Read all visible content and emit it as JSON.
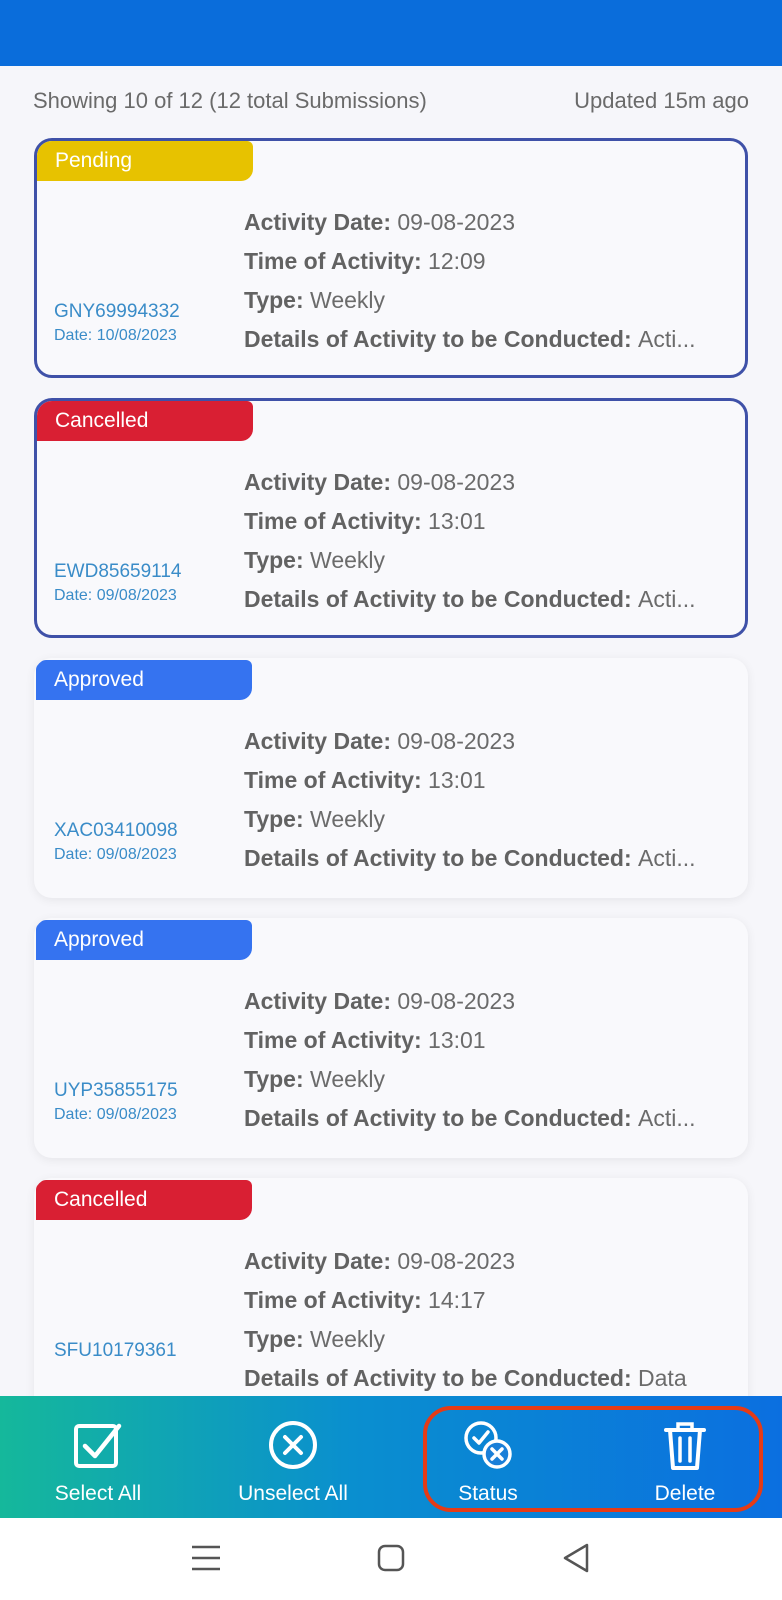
{
  "summary": {
    "showing": "Showing 10 of 12 (12 total Submissions)",
    "updated": "Updated 15m ago"
  },
  "labels": {
    "activity_date": "Activity Date",
    "time_of_activity": "Time of Activity",
    "type": "Type",
    "details": "Details of Activity to be Conducted"
  },
  "cards": [
    {
      "status": "Pending",
      "code": "GNY69994332",
      "date": "Date: 10/08/2023",
      "activity_date": "09-08-2023",
      "time": "12:09",
      "type": "Weekly",
      "details": "Acti..."
    },
    {
      "status": "Cancelled",
      "code": "EWD85659114",
      "date": "Date: 09/08/2023",
      "activity_date": "09-08-2023",
      "time": "13:01",
      "type": "Weekly",
      "details": "Acti..."
    },
    {
      "status": "Approved",
      "code": "XAC03410098",
      "date": "Date: 09/08/2023",
      "activity_date": "09-08-2023",
      "time": "13:01",
      "type": "Weekly",
      "details": "Acti..."
    },
    {
      "status": "Approved",
      "code": "UYP35855175",
      "date": "Date: 09/08/2023",
      "activity_date": "09-08-2023",
      "time": "13:01",
      "type": "Weekly",
      "details": "Acti..."
    },
    {
      "status": "Cancelled",
      "code": "SFU10179361",
      "date": "",
      "activity_date": "09-08-2023",
      "time": "14:17",
      "type": "Weekly",
      "details": "Data"
    }
  ],
  "actions": {
    "select_all": "Select All",
    "unselect_all": "Unselect All",
    "status": "Status",
    "delete": "Delete"
  },
  "colors": {
    "topbar": "#0a6ddb",
    "pending": "#e7c200",
    "cancelled": "#d91f33",
    "approved": "#3573f0",
    "selected_border": "#3f51a8",
    "highlight": "#e53b16"
  },
  "icons": {
    "select_all": "checkbox-check-icon",
    "unselect_all": "circle-x-icon",
    "status": "check-x-status-icon",
    "delete": "trash-icon",
    "nav_menu": "menu-icon",
    "nav_home": "square-home-icon",
    "nav_back": "triangle-back-icon"
  }
}
